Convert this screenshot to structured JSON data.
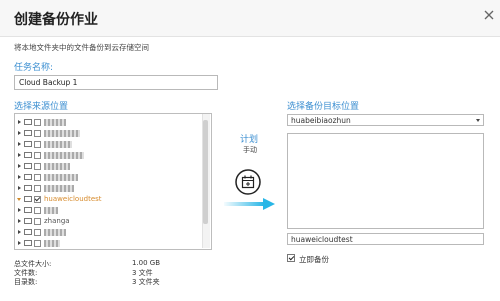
{
  "dialog": {
    "title": "创建备份作业"
  },
  "description": "将本地文件夹中的文件备份到云存储空间",
  "task": {
    "label": "任务名称:",
    "value": "Cloud Backup 1"
  },
  "source": {
    "label": "选择来源位置",
    "tree": [
      {
        "label": "",
        "checked": false,
        "expanded": false,
        "blurred": true
      },
      {
        "label": "",
        "checked": false,
        "expanded": false,
        "blurred": true
      },
      {
        "label": "",
        "checked": false,
        "expanded": false,
        "blurred": true
      },
      {
        "label": "",
        "checked": false,
        "expanded": false,
        "blurred": true
      },
      {
        "label": "",
        "checked": false,
        "expanded": false,
        "blurred": true
      },
      {
        "label": "",
        "checked": false,
        "expanded": false,
        "blurred": true
      },
      {
        "label": "",
        "checked": false,
        "expanded": false,
        "blurred": true
      },
      {
        "label": "huaweicloudtest",
        "checked": true,
        "expanded": true,
        "blurred": false,
        "selected": true
      },
      {
        "label": "",
        "checked": false,
        "expanded": false,
        "blurred": true
      },
      {
        "label": "zhanga",
        "checked": false,
        "expanded": false,
        "blurred": false
      },
      {
        "label": "",
        "checked": false,
        "expanded": false,
        "blurred": true
      },
      {
        "label": "",
        "checked": false,
        "expanded": false,
        "blurred": true
      }
    ]
  },
  "summary": [
    {
      "label": "总文件大小:",
      "value": "1.00 GB"
    },
    {
      "label": "文件数:",
      "value": "3 文件"
    },
    {
      "label": "目录数:",
      "value": "3 文件夹"
    }
  ],
  "schedule": {
    "label": "计划",
    "mode": "手动",
    "icon": "calendar-schedule-icon"
  },
  "flow": {
    "icon": "right-arrow-icon",
    "color": "#29b6e6"
  },
  "destination": {
    "label": "选择备份目标位置",
    "bucket": "huabeibiaozhun",
    "path": "huaweicloudtest"
  },
  "immediate_backup": {
    "label": "立即备份",
    "checked": true
  },
  "colors": {
    "accent": "#3c8fd1",
    "selected": "#d78b2c"
  }
}
